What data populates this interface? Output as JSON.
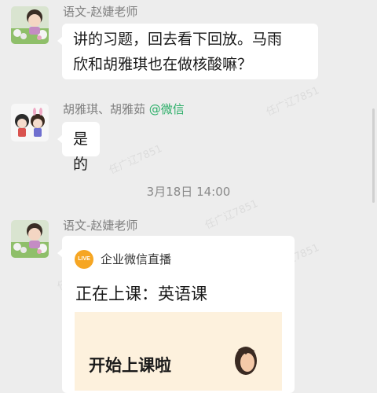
{
  "messages": [
    {
      "sender": "语文-赵婕老师",
      "text_line1": "讲的习题，回去看下回放。马雨",
      "text_line2": "欣和胡雅琪也在做核酸嘛？"
    },
    {
      "sender": "胡雅琪、胡雅茹",
      "sender_tag": "@微信",
      "text": "是的"
    }
  ],
  "timestamp": "3月18日   14:00",
  "live_message": {
    "sender": "语文-赵婕老师",
    "badge": "LIVE",
    "app_name": "企业微信直播",
    "title": "正在上课：英语课",
    "banner_text": "开始上课啦"
  },
  "watermark": "任广辽7851",
  "colors": {
    "background": "#ededed",
    "bubble": "#ffffff",
    "tag_green": "#2aae67",
    "live_orange": "#f6a623",
    "banner": "#fdf1dd"
  }
}
